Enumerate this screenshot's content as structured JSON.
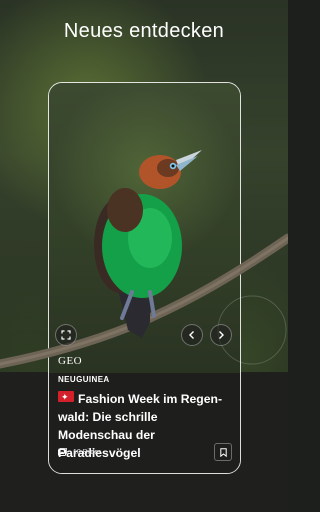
{
  "header": {
    "title": "Neues entdecken"
  },
  "card": {
    "brand": "GEO",
    "kicker": "NEUGUINEA",
    "title": "Fashion Week im Regen-wald: Die schrille Modenschau der Paradiesvögel",
    "meta": "10 Bilder"
  },
  "icons": {
    "expand": "expand-icon",
    "prev": "chevron-left-icon",
    "next": "chevron-right-icon",
    "gallery": "gallery-icon",
    "bookmark": "bookmark-icon",
    "flag": "flag-icon"
  },
  "colors": {
    "background": "#1f201d",
    "bird_green": "#1aa34a",
    "flag_red": "#d4202b"
  }
}
